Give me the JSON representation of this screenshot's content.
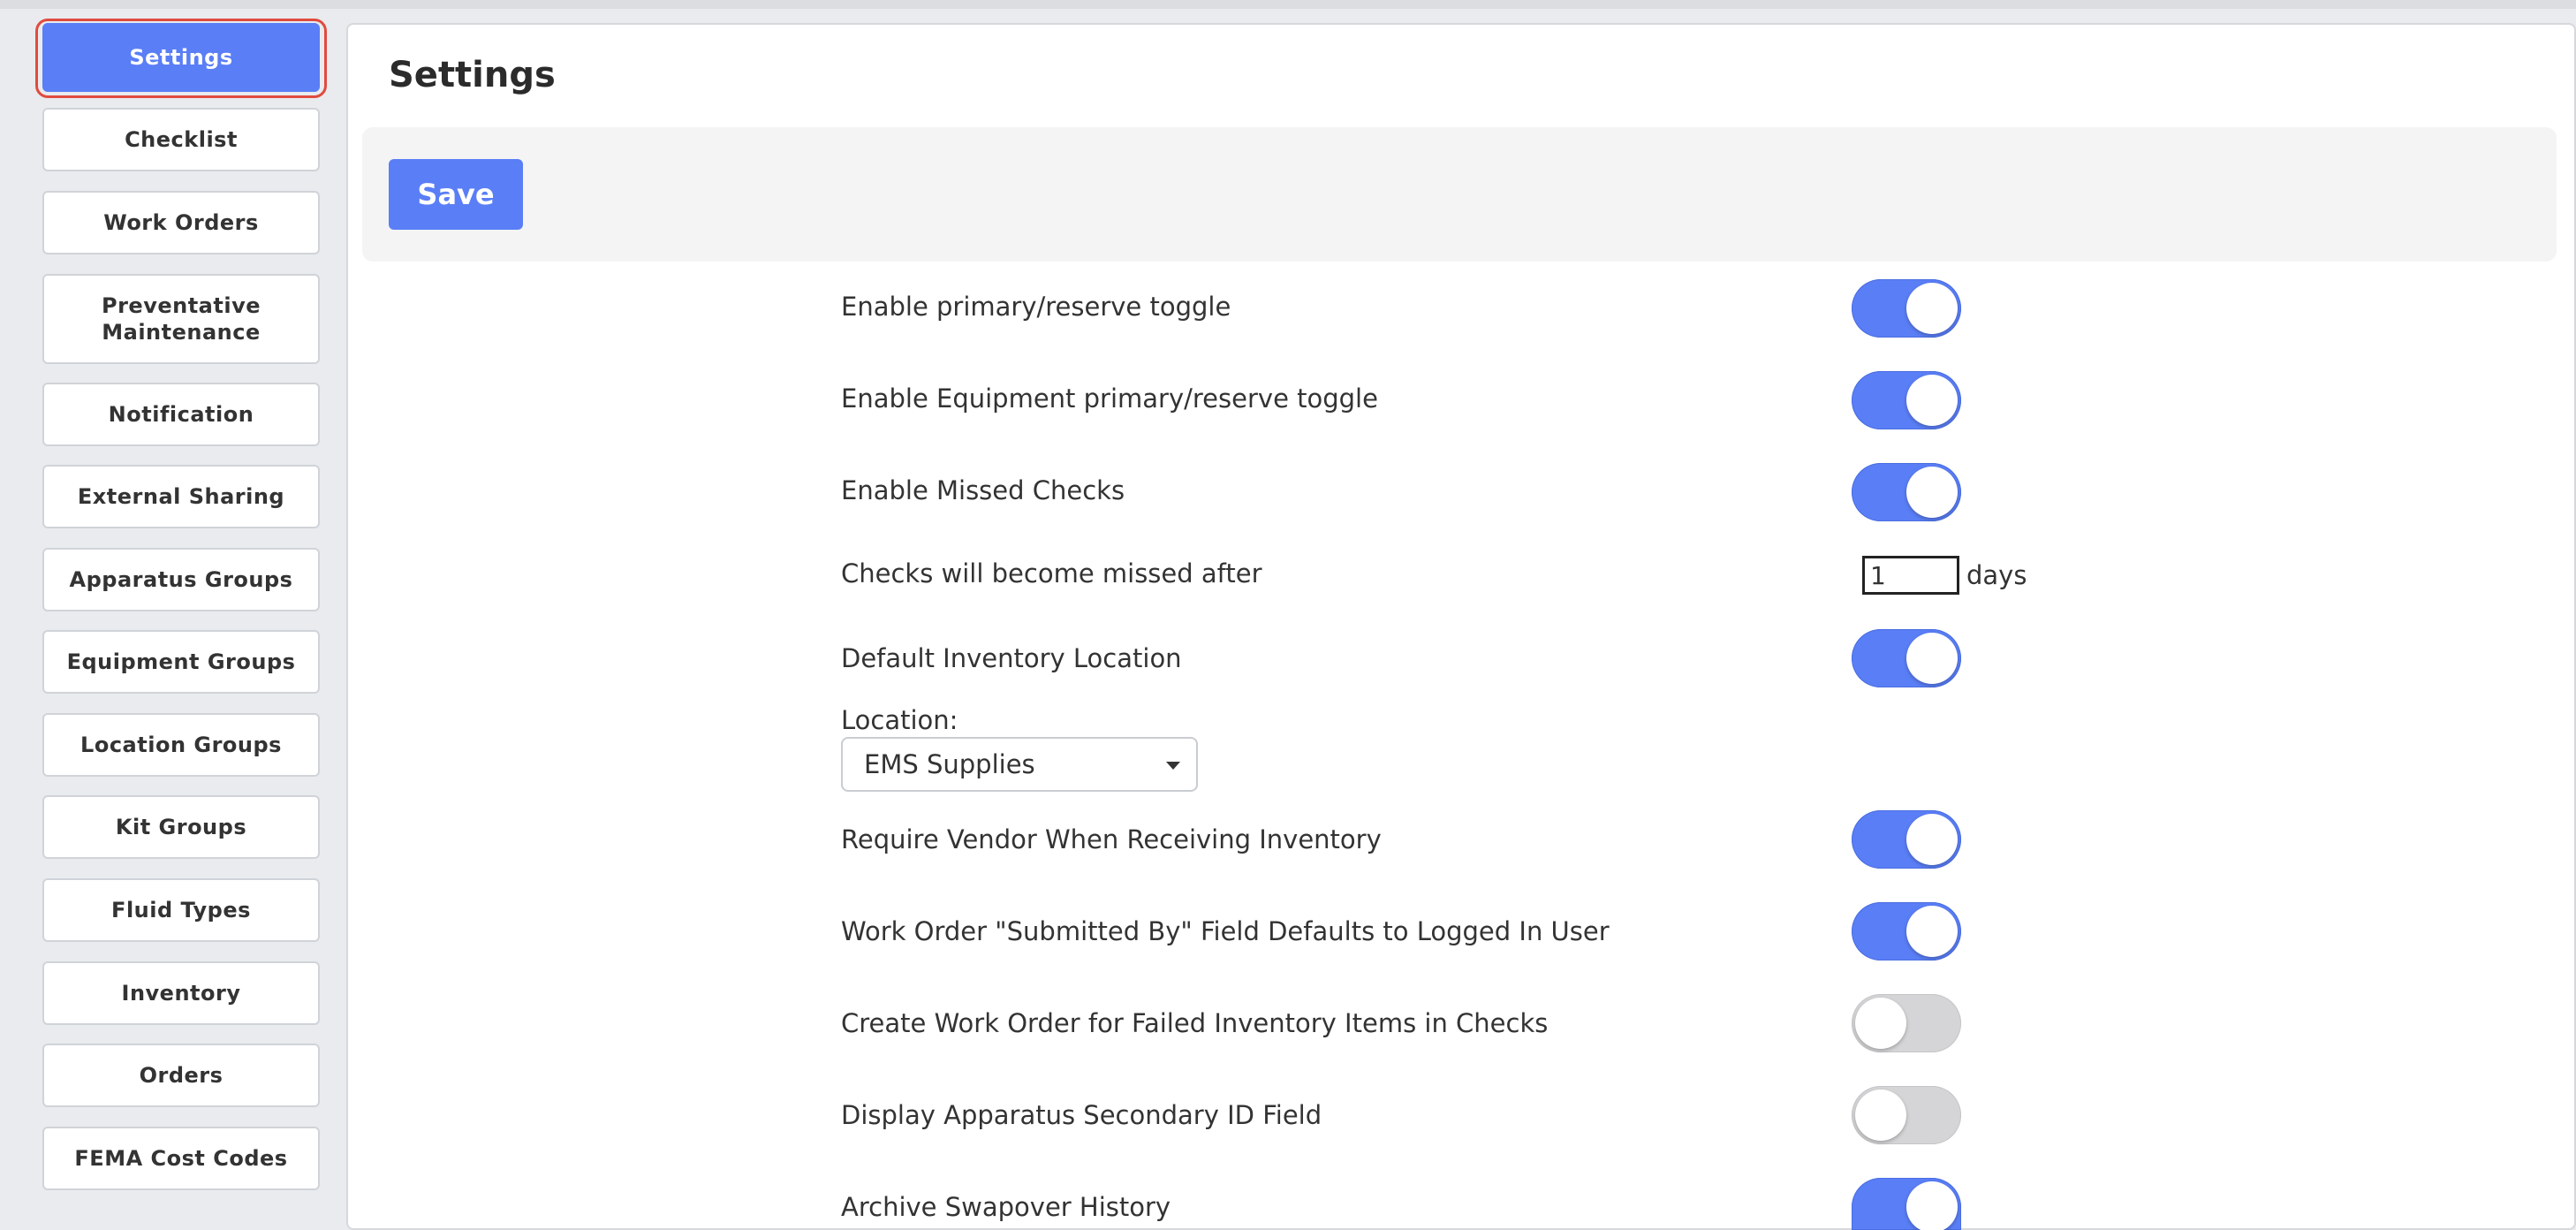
{
  "sidebar": {
    "items": [
      {
        "label": "Settings",
        "active": true
      },
      {
        "label": "Checklist"
      },
      {
        "label": "Work Orders"
      },
      {
        "label": "Preventative\nMaintenance"
      },
      {
        "label": "Notification"
      },
      {
        "label": "External Sharing"
      },
      {
        "label": "Apparatus Groups"
      },
      {
        "label": "Equipment Groups"
      },
      {
        "label": "Location Groups"
      },
      {
        "label": "Kit Groups"
      },
      {
        "label": "Fluid Types"
      },
      {
        "label": "Inventory"
      },
      {
        "label": "Orders"
      },
      {
        "label": "FEMA Cost Codes"
      }
    ]
  },
  "main": {
    "title": "Settings",
    "save_label": "Save",
    "settings": [
      {
        "label": "Enable primary/reserve toggle",
        "state": "on"
      },
      {
        "label": "Enable Equipment primary/reserve toggle",
        "state": "on"
      },
      {
        "label": "Enable Missed Checks",
        "state": "on"
      },
      {
        "label": "Checks will become missed after"
      },
      {
        "label": "Default Inventory Location",
        "state": "on"
      },
      {
        "label": "Require Vendor When Receiving Inventory",
        "state": "on"
      },
      {
        "label": "Work Order \"Submitted By\" Field Defaults to Logged In User",
        "state": "on"
      },
      {
        "label": "Create Work Order for Failed Inventory Items in Checks",
        "state": "off"
      },
      {
        "label": "Display Apparatus Secondary ID Field",
        "state": "off"
      },
      {
        "label": "Archive Swapover History",
        "state": "on"
      }
    ],
    "missed_after": {
      "value": "1",
      "unit": "days"
    },
    "location": {
      "label": "Location:",
      "selected": "EMS Supplies"
    }
  },
  "colors": {
    "accent": "#5a7ef6",
    "toggle_off": "#d5d5d7",
    "active_ring": "#e04b3f"
  }
}
